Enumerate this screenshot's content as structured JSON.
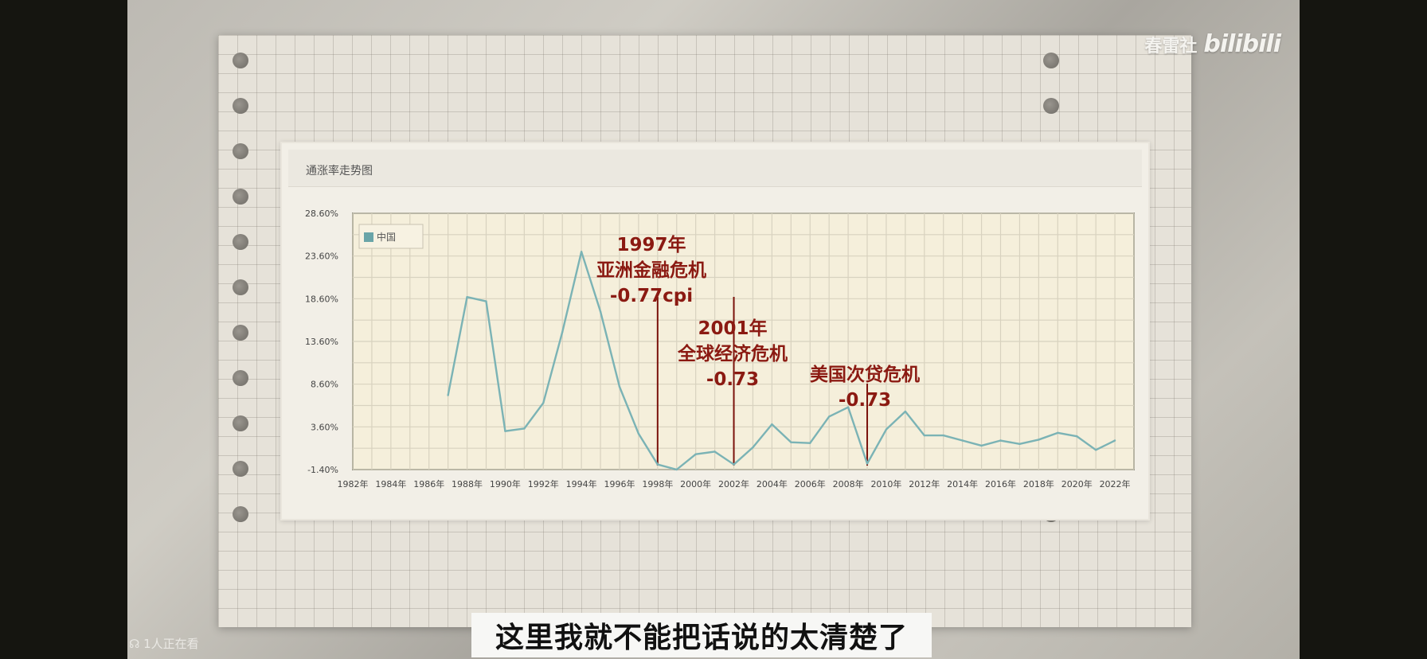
{
  "watermark": {
    "channel": "春雷社",
    "brand": "bilibili"
  },
  "card": {
    "title": "通涨率走势图"
  },
  "subtitle": "这里我就不能把话说的太清楚了",
  "viewers": "1人正在看",
  "colors": {
    "line": "#7bb3b5",
    "annotation": "#8b1a12",
    "legend_swatch": "#6aa5a8"
  },
  "chart_data": {
    "type": "line",
    "title": "通涨率走势图",
    "legend_position": "top-left",
    "grid": true,
    "x": [
      1987,
      1988,
      1989,
      1990,
      1991,
      1992,
      1993,
      1994,
      1995,
      1996,
      1997,
      1998,
      1999,
      2000,
      2001,
      2002,
      2003,
      2004,
      2005,
      2006,
      2007,
      2008,
      2009,
      2010,
      2011,
      2012,
      2013,
      2014,
      2015,
      2016,
      2017,
      2018,
      2019,
      2020,
      2021,
      2022
    ],
    "x_ticks": [
      "1982年",
      "1984年",
      "1986年",
      "1988年",
      "1990年",
      "1992年",
      "1994年",
      "1996年",
      "1998年",
      "2000年",
      "2002年",
      "2004年",
      "2006年",
      "2008年",
      "2010年",
      "2012年",
      "2014年",
      "2016年",
      "2018年",
      "2020年",
      "2022年"
    ],
    "xlim": [
      1982,
      2023
    ],
    "ylim": [
      -1.4,
      28.6
    ],
    "y_ticks": [
      "28.60%",
      "23.60%",
      "18.60%",
      "13.60%",
      "8.60%",
      "3.60%",
      "-1.40%"
    ],
    "series": [
      {
        "name": "中国",
        "values": [
          7.3,
          18.8,
          18.3,
          3.1,
          3.4,
          6.4,
          14.7,
          24.1,
          17.1,
          8.3,
          2.8,
          -0.8,
          -1.4,
          0.4,
          0.7,
          -0.8,
          1.2,
          3.9,
          1.8,
          1.7,
          4.8,
          5.9,
          -0.7,
          3.3,
          5.4,
          2.6,
          2.6,
          2.0,
          1.4,
          2.0,
          1.6,
          2.1,
          2.9,
          2.5,
          0.9,
          2.0
        ]
      }
    ],
    "annotations": [
      {
        "x": 1998,
        "lines": [
          "1997年",
          "亚洲金融危机",
          "-0.77cpi"
        ]
      },
      {
        "x": 2002,
        "lines": [
          "2001年",
          "全球经济危机",
          "-0.73"
        ]
      },
      {
        "x": 2009,
        "lines": [
          "美国次贷危机",
          "-0.73"
        ]
      }
    ]
  }
}
